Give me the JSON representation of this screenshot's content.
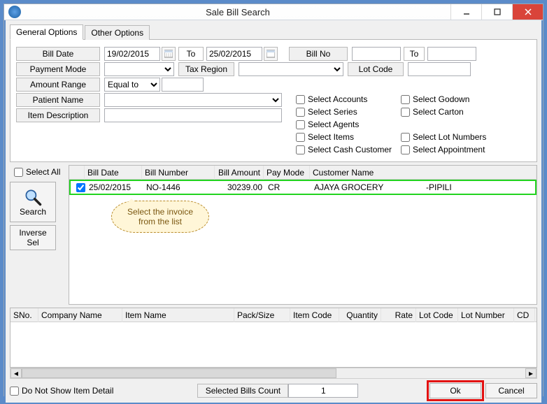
{
  "window": {
    "title": "Sale Bill Search"
  },
  "tabs": {
    "general": "General Options",
    "other": "Other Options"
  },
  "fields": {
    "bill_date": "Bill Date",
    "date_from": "19/02/2015",
    "to": "To",
    "date_to": "25/02/2015",
    "bill_no": "Bill No",
    "payment_mode": "Payment Mode",
    "tax_region": "Tax Region",
    "lot_code": "Lot Code",
    "amount_range": "Amount Range",
    "amount_op": "Equal to",
    "patient_name": "Patient Name",
    "item_desc": "Item Description"
  },
  "checks": {
    "c1": "Select Accounts",
    "c2": "Select Godown",
    "c3": "Select Series",
    "c4": "Select Carton",
    "c5": "Select Agents",
    "c6": "Select Items",
    "c7": "Select Lot Numbers",
    "c8": "Select Cash Customer",
    "c9": "Select Appointment"
  },
  "left": {
    "select_all": "Select All",
    "search": "Search",
    "inverse": "Inverse Sel"
  },
  "grid1": {
    "cols": {
      "c0": "",
      "c1": "Bill Date",
      "c2": "Bill Number",
      "c3": "Bill Amount",
      "c4": "Pay Mode",
      "c5": "Customer Name",
      "c6": ""
    },
    "row": {
      "date": "25/02/2015",
      "no": "NO-1446",
      "amt": "30239.00",
      "pm": "CR",
      "cust": "AJAYA GROCERY",
      "extra": "-PIPILI"
    }
  },
  "callout": "Select the invoice from the list",
  "grid2": {
    "cols": {
      "c0": "SNo.",
      "c1": "Company Name",
      "c2": "Item Name",
      "c3": "Pack/Size",
      "c4": "Item Code",
      "c5": "Quantity",
      "c6": "Rate",
      "c7": "Lot Code",
      "c8": "Lot Number",
      "c9": "CD"
    }
  },
  "footer": {
    "donot": "Do Not Show Item Detail",
    "sel_count_lbl": "Selected Bills Count",
    "sel_count": "1",
    "ok": "Ok",
    "cancel": "Cancel"
  }
}
